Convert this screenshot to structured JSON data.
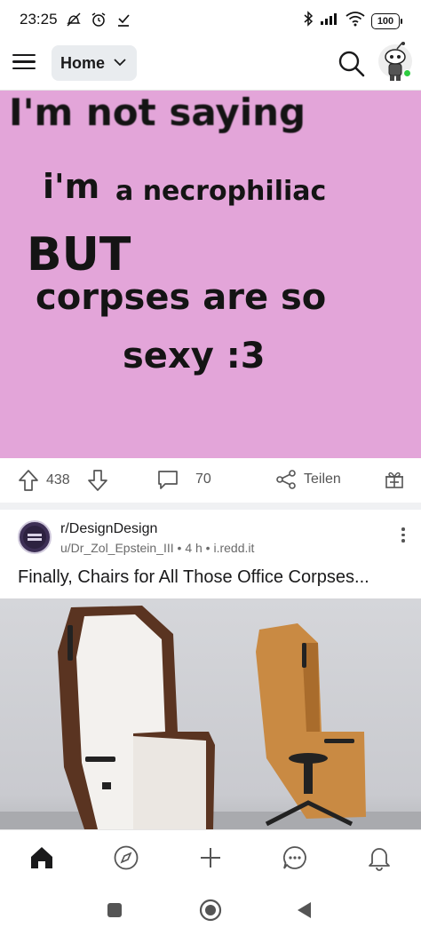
{
  "status_bar": {
    "time": "23:25",
    "left_icons": [
      "mute-icon",
      "alarm-icon",
      "download-check-icon"
    ],
    "right_icons": [
      "bluetooth-icon",
      "signal-icon",
      "wifi-icon"
    ],
    "battery": "100"
  },
  "header": {
    "feed_label": "Home"
  },
  "post1": {
    "meme_lines": [
      "I'm not saying",
      "i'm",
      "a necrophiliac",
      "BUT",
      "corpses are so",
      "sexy :3"
    ],
    "upvotes": "438",
    "comments": "70",
    "share_label": "Teilen",
    "colors": {
      "meme_background": "#e3a5d9"
    }
  },
  "post2": {
    "subreddit": "r/DesignDesign",
    "author": "u/Dr_Zol_Epstein_III",
    "age": "4 h",
    "domain": "i.redd.it",
    "separator": "•",
    "title": "Finally, Chairs for All Those Office Corpses..."
  },
  "bottom_nav": [
    "home-icon",
    "explore-icon",
    "create-icon",
    "chat-icon",
    "notifications-icon"
  ],
  "system_nav": [
    "recents-icon",
    "home-circle-icon",
    "back-icon"
  ]
}
